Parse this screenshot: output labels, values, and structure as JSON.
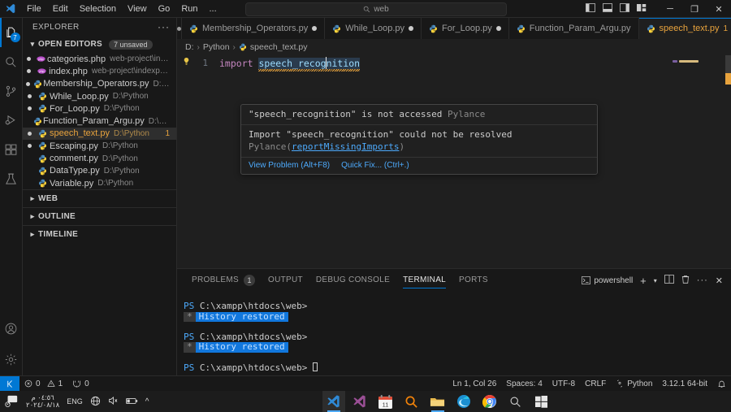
{
  "titlebar": {
    "logo_icon": "vscode-logo-icon",
    "menus": [
      "File",
      "Edit",
      "Selection",
      "View",
      "Go",
      "Run",
      "..."
    ],
    "back_icon": "arrow-left-icon",
    "forward_icon": "arrow-right-icon",
    "search": {
      "value": "web",
      "icon": "search-icon"
    },
    "layout_icons": [
      "toggle-primary-sidebar-icon",
      "toggle-panel-icon",
      "toggle-secondary-sidebar-icon",
      "customize-layout-icon"
    ],
    "window_controls": {
      "minimize": "─",
      "maximize": "❐",
      "close": "✕"
    }
  },
  "activitybar": {
    "items": [
      {
        "name": "explorer",
        "icon": "files-icon",
        "badge": "7",
        "active": true
      },
      {
        "name": "search",
        "icon": "search-icon",
        "badge": "",
        "active": false
      },
      {
        "name": "source-control",
        "icon": "source-control-icon",
        "badge": "",
        "active": false
      },
      {
        "name": "run-debug",
        "icon": "run-and-debug-icon",
        "badge": "",
        "active": false
      },
      {
        "name": "extensions",
        "icon": "extensions-icon",
        "badge": "",
        "active": false
      },
      {
        "name": "testing",
        "icon": "beaker-icon",
        "badge": "",
        "active": false
      }
    ],
    "bottom": [
      {
        "name": "accounts",
        "icon": "account-icon"
      },
      {
        "name": "settings",
        "icon": "gear-icon"
      }
    ]
  },
  "sidebar": {
    "title": "EXPLORER",
    "more_actions": "···",
    "open_editors": {
      "label": "OPEN EDITORS",
      "badge": "7 unsaved",
      "items": [
        {
          "name": "categories.php",
          "path": "web-project\\inde…",
          "icon": "php-icon",
          "dirty": true,
          "count": "",
          "selected": false
        },
        {
          "name": "index.php",
          "path": "web-project\\indexpage",
          "icon": "php-icon",
          "dirty": true,
          "count": "",
          "selected": false
        },
        {
          "name": "Membership_Operators.py",
          "path": "D:\\P…",
          "icon": "python-icon",
          "dirty": true,
          "count": "",
          "selected": false
        },
        {
          "name": "While_Loop.py",
          "path": "D:\\Python",
          "icon": "python-icon",
          "dirty": true,
          "count": "",
          "selected": false
        },
        {
          "name": "For_Loop.py",
          "path": "D:\\Python",
          "icon": "python-icon",
          "dirty": true,
          "count": "",
          "selected": false
        },
        {
          "name": "Function_Param_Argu.py",
          "path": "D:\\Pyt…",
          "icon": "python-icon",
          "dirty": false,
          "count": "",
          "selected": false
        },
        {
          "name": "speech_text.py",
          "path": "D:\\Python",
          "icon": "python-icon",
          "dirty": true,
          "count": "1",
          "selected": true
        },
        {
          "name": "Escaping.py",
          "path": "D:\\Python",
          "icon": "python-icon",
          "dirty": true,
          "count": "",
          "selected": false
        },
        {
          "name": "comment.py",
          "path": "D:\\Python",
          "icon": "python-icon",
          "dirty": false,
          "count": "",
          "selected": false
        },
        {
          "name": "DataType.py",
          "path": "D:\\Python",
          "icon": "python-icon",
          "dirty": false,
          "count": "",
          "selected": false
        },
        {
          "name": "Variable.py",
          "path": "D:\\Python",
          "icon": "python-icon",
          "dirty": false,
          "count": "",
          "selected": false
        }
      ]
    },
    "collapsed_sections": [
      "WEB",
      "OUTLINE",
      "TIMELINE"
    ]
  },
  "editor": {
    "tabs": [
      {
        "label": "Membership_Operators.py",
        "icon": "python-icon",
        "dirty": true,
        "count": "",
        "active": false
      },
      {
        "label": "While_Loop.py",
        "icon": "python-icon",
        "dirty": true,
        "count": "",
        "active": false
      },
      {
        "label": "For_Loop.py",
        "icon": "python-icon",
        "dirty": true,
        "count": "",
        "active": false
      },
      {
        "label": "Function_Param_Argu.py",
        "icon": "python-icon",
        "dirty": false,
        "count": "",
        "active": false
      },
      {
        "label": "speech_text.py",
        "icon": "python-icon",
        "dirty": true,
        "count": "1",
        "active": true
      }
    ],
    "tab_actions": [
      "run-python-file-icon",
      "chevron-down-icon",
      "split-editor-icon",
      "more-actions-icon"
    ],
    "breadcrumb": {
      "drive": "D:",
      "folder": "Python",
      "file": "speech_text.py",
      "file_icon": "python-icon",
      "separator": "›"
    },
    "gutter_lightbulb": "lightbulb-icon",
    "line_number": "1",
    "code": {
      "keyword": "import",
      "module": "speech_recognition"
    },
    "hover": {
      "line1_quoted": "\"speech_recognition\"",
      "line1_rest": " is not accessed",
      "line1_source": "Pylance",
      "line2_prefix": "Import ",
      "line2_quoted": "\"speech_recognition\"",
      "line2_rest": " could not be resolved",
      "line2_source": "Pylance",
      "line2_rule": "reportMissingImports",
      "action_view_problem": "View Problem (Alt+F8)",
      "action_quick_fix": "Quick Fix... (Ctrl+.)"
    },
    "minimap_color": "#d7ba7d",
    "overview_marker_color": "#e8a33d"
  },
  "panel": {
    "tabs": [
      {
        "label": "PROBLEMS",
        "badge": "1",
        "active": false
      },
      {
        "label": "OUTPUT",
        "badge": "",
        "active": false
      },
      {
        "label": "DEBUG CONSOLE",
        "badge": "",
        "active": false
      },
      {
        "label": "TERMINAL",
        "badge": "",
        "active": true
      },
      {
        "label": "PORTS",
        "badge": "",
        "active": false
      }
    ],
    "shell": {
      "label": "powershell",
      "icon": "terminal-icon"
    },
    "actions": [
      "new-terminal-icon",
      "chevron-down-icon",
      "split-terminal-icon",
      "kill-terminal-icon",
      "more-actions-icon",
      "close-panel-icon"
    ],
    "terminal_lines": [
      {
        "type": "prompt",
        "ps": "PS",
        "path": "C:\\xampp\\htdocs\\web>"
      },
      {
        "type": "history",
        "star": "*",
        "text": "History restored"
      },
      {
        "type": "blank"
      },
      {
        "type": "prompt",
        "ps": "PS",
        "path": "C:\\xampp\\htdocs\\web>"
      },
      {
        "type": "history",
        "star": "*",
        "text": "History restored"
      },
      {
        "type": "blank"
      },
      {
        "type": "prompt-cursor",
        "ps": "PS",
        "path": "C:\\xampp\\htdocs\\web>"
      }
    ]
  },
  "statusbar": {
    "remote_icon": "remote-window-icon",
    "errors": {
      "icon": "error-icon",
      "count": "0"
    },
    "warnings": {
      "icon": "warning-icon",
      "count": "1"
    },
    "ports": {
      "icon": "ports-icon",
      "count": "0"
    },
    "right": [
      {
        "name": "cursor-position",
        "label": "Ln 1, Col 26"
      },
      {
        "name": "indentation",
        "label": "Spaces: 4"
      },
      {
        "name": "encoding",
        "label": "UTF-8"
      },
      {
        "name": "eol",
        "label": "CRLF"
      },
      {
        "name": "language-mode",
        "label": "Python",
        "icon": "python-lang-icon"
      },
      {
        "name": "interpreter",
        "label": "3.12.1 64-bit"
      },
      {
        "name": "notifications",
        "label": "",
        "icon": "bell-icon"
      }
    ]
  },
  "taskbar": {
    "tray": {
      "notification_icon": "notification-bubble-icon",
      "time": "٠٤:٥٦ م",
      "date": "٢٠٢٤/٠٨/١٨",
      "language": "ENG",
      "network_icon": "network-globe-icon",
      "volume_icon": "volume-muted-icon",
      "battery_icon": "battery-icon",
      "chevron_icon": "chevron-up-icon"
    },
    "apps": [
      {
        "name": "vscode",
        "icon": "vscode-icon",
        "running": true,
        "active": true
      },
      {
        "name": "visual-studio",
        "icon": "visual-studio-icon",
        "running": false,
        "active": false
      },
      {
        "name": "calendar",
        "icon": "calendar-icon",
        "running": false,
        "active": false
      },
      {
        "name": "search-orange",
        "icon": "magnifier-orange-icon",
        "running": false,
        "active": false
      },
      {
        "name": "file-explorer",
        "icon": "folder-icon",
        "running": true,
        "active": false
      },
      {
        "name": "edge",
        "icon": "edge-icon",
        "running": false,
        "active": false
      },
      {
        "name": "chrome",
        "icon": "chrome-icon",
        "running": false,
        "active": false
      },
      {
        "name": "search",
        "icon": "search-icon",
        "running": false,
        "active": false
      },
      {
        "name": "start",
        "icon": "windows-start-icon",
        "running": false,
        "active": false
      }
    ]
  },
  "colors": {
    "accent": "#0078d4",
    "active_tab_text": "#e8a33d",
    "terminal_highlight": "#1177dd",
    "python_icon": "#3572A5"
  }
}
